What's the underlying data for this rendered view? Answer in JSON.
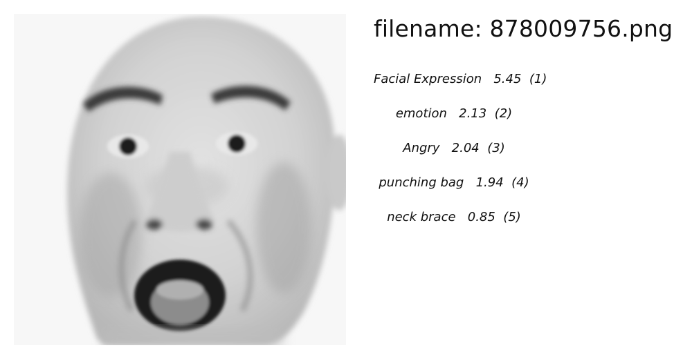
{
  "header": {
    "filename_prefix": "filename: ",
    "filename": "878009756.png"
  },
  "photo": {
    "subject": "grayscale close-up of a shocked/screaming bald man's face"
  },
  "labels": [
    {
      "name": "Facial Expression",
      "score": "5.45",
      "rank": "(1)"
    },
    {
      "name": "emotion",
      "score": "2.13",
      "rank": "(2)"
    },
    {
      "name": "Angry",
      "score": "2.04",
      "rank": "(3)"
    },
    {
      "name": "punching bag",
      "score": "1.94",
      "rank": "(4)"
    },
    {
      "name": "neck brace",
      "score": "0.85",
      "rank": "(5)"
    }
  ]
}
